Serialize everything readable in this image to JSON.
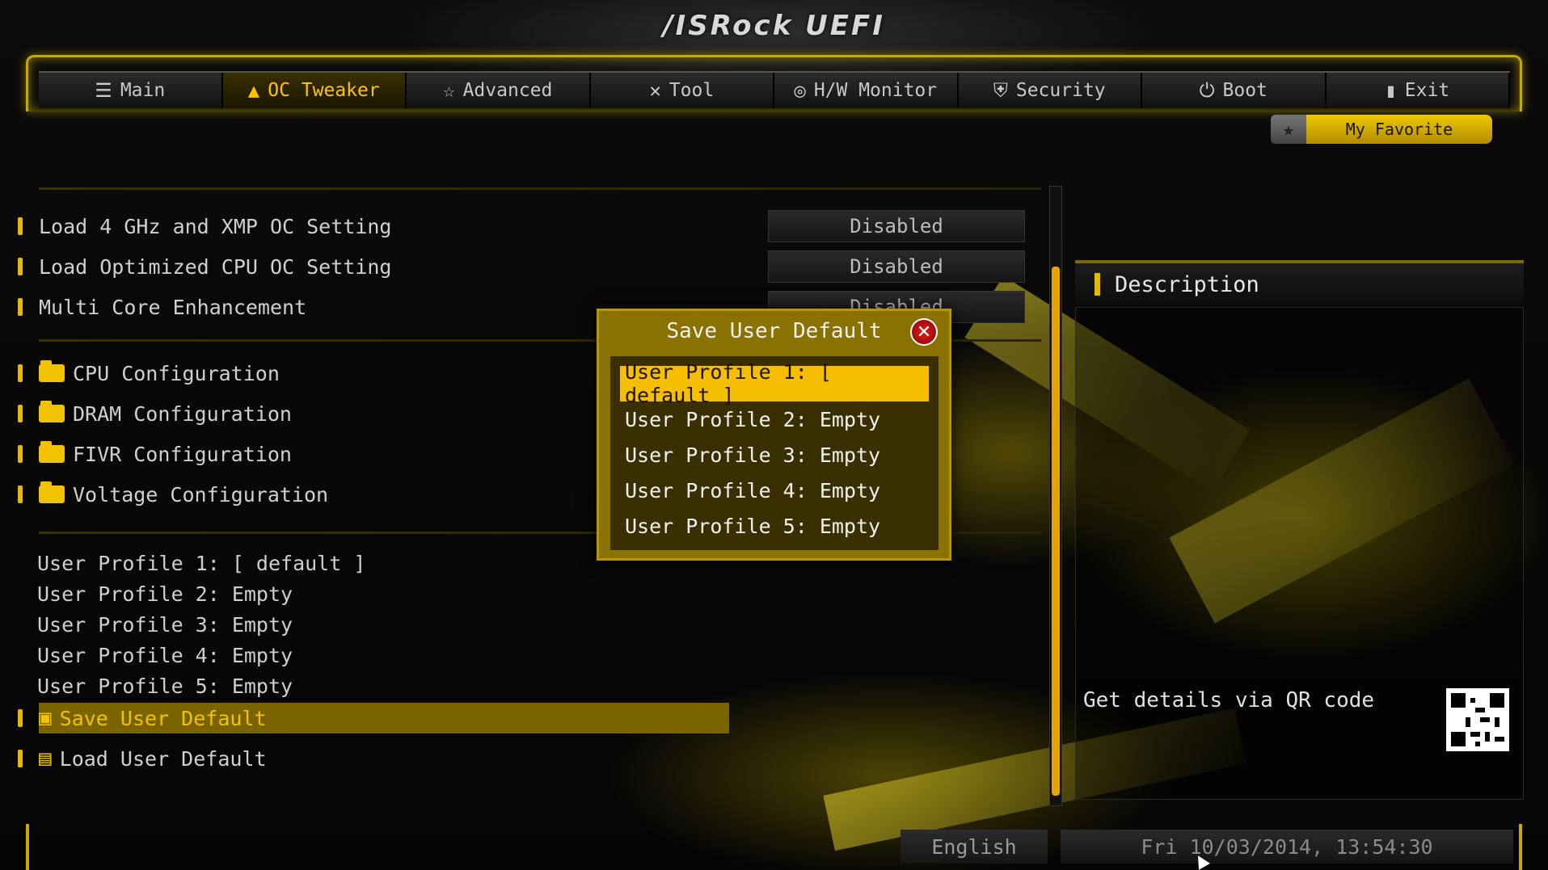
{
  "header": {
    "logo": "/ISRock UEFI"
  },
  "tabs": [
    {
      "label": "Main",
      "icon": "list-icon"
    },
    {
      "label": "OC Tweaker",
      "icon": "flame-icon",
      "active": true
    },
    {
      "label": "Advanced",
      "icon": "star-icon"
    },
    {
      "label": "Tool",
      "icon": "tools-icon"
    },
    {
      "label": "H/W Monitor",
      "icon": "monitor-icon"
    },
    {
      "label": "Security",
      "icon": "shield-icon"
    },
    {
      "label": "Boot",
      "icon": "power-icon"
    },
    {
      "label": "Exit",
      "icon": "exit-icon"
    }
  ],
  "favorite": {
    "label": "My Favorite"
  },
  "settings": [
    {
      "label": "Load 4 GHz and XMP OC Setting",
      "value": "Disabled"
    },
    {
      "label": "Load Optimized CPU OC Setting",
      "value": "Disabled"
    },
    {
      "label": "Multi Core Enhancement",
      "value": "Disabled"
    }
  ],
  "folders": [
    {
      "label": "CPU Configuration"
    },
    {
      "label": "DRAM Configuration"
    },
    {
      "label": "FIVR Configuration"
    },
    {
      "label": "Voltage Configuration"
    }
  ],
  "profiles": [
    "User Profile 1: [ default ]",
    "User Profile 2: Empty",
    "User Profile 3: Empty",
    "User Profile 4: Empty",
    "User Profile 5: Empty"
  ],
  "actions": {
    "save": "Save User Default",
    "load": "Load User Default"
  },
  "description": {
    "title": "Description",
    "qr_text": "Get details via QR code"
  },
  "footer": {
    "language": "English",
    "datetime": "Fri 10/03/2014, 13:54:30"
  },
  "modal": {
    "title": "Save User Default",
    "options": [
      "User Profile 1: [ default ]",
      "User Profile 2: Empty",
      "User Profile 3: Empty",
      "User Profile 4: Empty",
      "User Profile 5: Empty"
    ],
    "selected_index": 0
  },
  "colors": {
    "accent": "#f5be00",
    "accent_dark": "#8a7200",
    "text": "#d0d0d0"
  }
}
